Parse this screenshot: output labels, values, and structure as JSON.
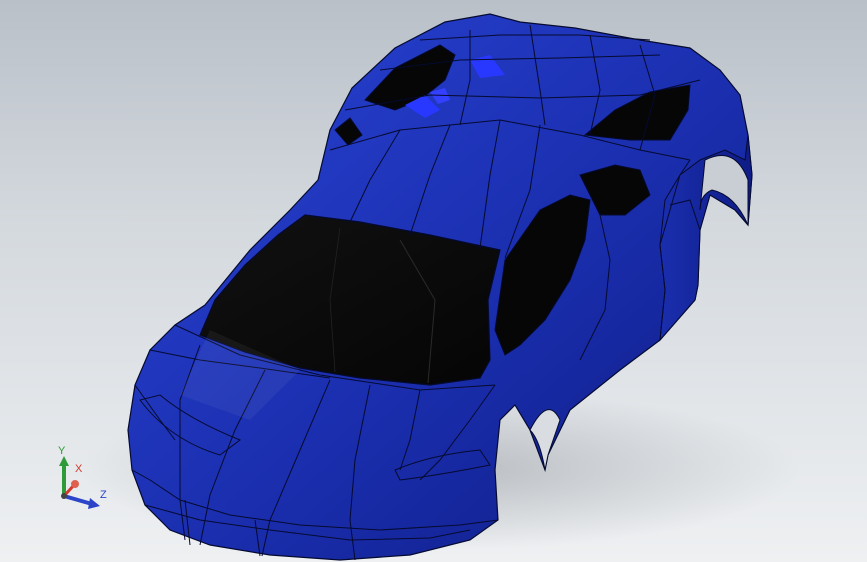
{
  "viewport": {
    "model": "car-body",
    "colors": {
      "body": "#1b2fb0",
      "body_light": "#2c46d8",
      "body_dark": "#0b1670",
      "glass": "#0a0a0a",
      "edge": "#050a30",
      "background_top": "#b9c0c8",
      "background_bottom": "#eef0f2"
    }
  },
  "triad": {
    "x_label": "X",
    "y_label": "Y",
    "z_label": "Z",
    "colors": {
      "x": "#d23a2e",
      "y": "#2e9a3a",
      "z": "#2b44c8"
    }
  }
}
